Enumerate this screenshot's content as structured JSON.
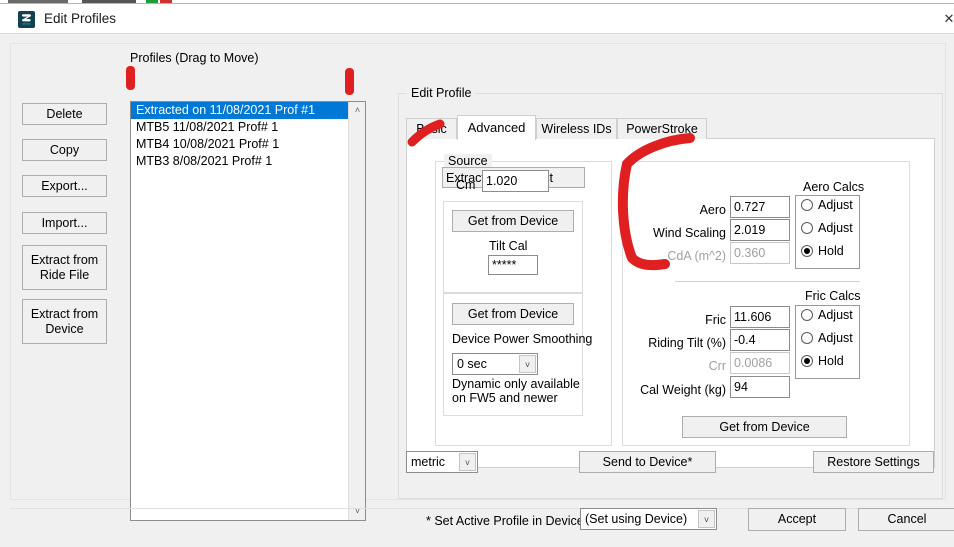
{
  "window": {
    "title": "Edit Profiles",
    "icon": "app-logo-icon",
    "close_label": "✕"
  },
  "left_buttons": [
    {
      "label": "Delete",
      "name": "delete-button"
    },
    {
      "label": "Copy",
      "name": "copy-button"
    },
    {
      "label": "Export...",
      "name": "export-button"
    },
    {
      "label": "Import...",
      "name": "import-button"
    },
    {
      "label": "Extract from\nRide File",
      "name": "extract-from-ride-file-button"
    },
    {
      "label": "Extract from\nDevice",
      "name": "extract-from-device-button"
    }
  ],
  "profiles": {
    "label": "Profiles (Drag to Move)",
    "items": [
      {
        "label": "Extracted on 11/08/2021 Prof #1",
        "selected": true
      },
      {
        "label": "MTB5 11/08/2021 Prof# 1",
        "selected": false
      },
      {
        "label": "MTB4 10/08/2021 Prof# 1",
        "selected": false
      },
      {
        "label": "MTB3 8/08/2021 Prof# 1",
        "selected": false
      }
    ],
    "scroll_up": "˄",
    "scroll_down": "˅"
  },
  "edit_profile": {
    "group_title": "Edit Profile",
    "tabs": [
      {
        "label": "Basic",
        "active": false
      },
      {
        "label": "Advanced",
        "active": true
      },
      {
        "label": "Wireless IDs",
        "active": false
      },
      {
        "label": "PowerStroke",
        "active": false
      }
    ],
    "source": {
      "group_title": "Source",
      "source_value": "Extracted from Unit",
      "cm_label": "Cm",
      "cm_value": "1.020",
      "tilt": {
        "get_from_device_label": "Get from Device",
        "tilt_cal_label": "Tilt Cal",
        "tilt_cal_value": "*****"
      },
      "smoothing": {
        "get_from_device_label": "Get from Device",
        "label": "Device Power Smoothing",
        "value": "0 sec",
        "note": "Dynamic only available on FW5 and newer",
        "dropdown_arrow": "˅"
      }
    },
    "calcs": {
      "aero": {
        "title": "Aero Calcs",
        "rows": [
          {
            "label": "Aero",
            "value": "0.727",
            "disabled": false,
            "radio": "Adjust",
            "checked": false
          },
          {
            "label": "Wind Scaling",
            "value": "2.019",
            "disabled": false,
            "radio": "Adjust",
            "checked": false
          },
          {
            "label": "CdA (m^2)",
            "value": "0.360",
            "disabled": true,
            "radio": "Hold",
            "checked": true
          }
        ]
      },
      "fric": {
        "title": "Fric Calcs",
        "rows": [
          {
            "label": "Fric",
            "value": "11.606",
            "disabled": false,
            "radio": "Adjust",
            "checked": false
          },
          {
            "label": "Riding Tilt (%)",
            "value": "-0.4",
            "disabled": false,
            "radio": "Adjust",
            "checked": false
          },
          {
            "label": "Crr",
            "value": "0.0086",
            "disabled": true,
            "radio": "Hold",
            "checked": true
          }
        ],
        "cal_weight_label": "Cal Weight (kg)",
        "cal_weight_value": "94",
        "get_from_device_label": "Get from Device"
      }
    },
    "bottom": {
      "units_value": "metric",
      "units_arrow": "˅",
      "send_to_device_label": "Send to Device*",
      "restore_settings_label": "Restore Settings"
    }
  },
  "footer": {
    "active_profile_label": "* Set Active Profile in Device",
    "active_profile_value": "(Set using Device)",
    "active_profile_arrow": "˅",
    "accept_label": "Accept",
    "cancel_label": "Cancel"
  },
  "colors": {
    "selection_blue": "#0078d7",
    "annotation_red": "#e02020",
    "window_bg": "#f0f0f0"
  }
}
